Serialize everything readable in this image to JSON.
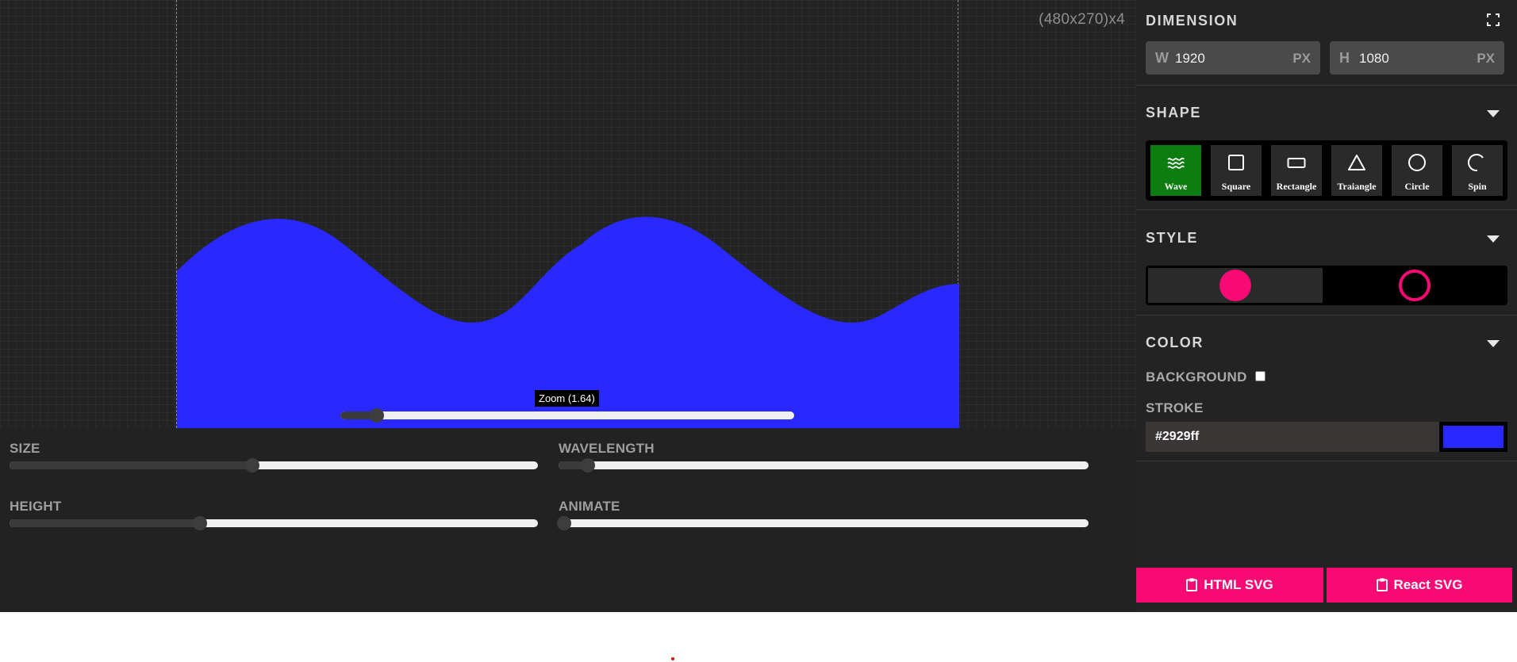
{
  "canvas": {
    "scale_label": "(480x270)x4",
    "wave_color": "#2929ff",
    "zoom": {
      "tooltip": "Zoom (1.64)",
      "value": 1.64,
      "fraction": 0.08
    }
  },
  "controls": {
    "size": {
      "label": "SIZE",
      "fraction": 0.46
    },
    "wavelength": {
      "label": "WAVELENGTH",
      "fraction": 0.055
    },
    "height": {
      "label": "HEIGHT",
      "fraction": 0.36
    },
    "animate": {
      "label": "ANIMATE",
      "fraction": 0.01
    }
  },
  "panel": {
    "dimension": {
      "title": "DIMENSION",
      "width": {
        "letter": "W",
        "value": "1920",
        "unit": "PX"
      },
      "height": {
        "letter": "H",
        "value": "1080",
        "unit": "PX"
      }
    },
    "shape": {
      "title": "SHAPE",
      "options": [
        {
          "label": "Wave",
          "icon": "wave-icon",
          "active": true
        },
        {
          "label": "Square",
          "icon": "square-icon",
          "active": false
        },
        {
          "label": "Rectangle",
          "icon": "rectangle-icon",
          "active": false
        },
        {
          "label": "Traiangle",
          "icon": "triangle-icon",
          "active": false
        },
        {
          "label": "Circle",
          "icon": "circle-icon",
          "active": false
        },
        {
          "label": "Spin",
          "icon": "spin-icon",
          "active": false
        }
      ]
    },
    "style": {
      "title": "STYLE",
      "accent": "#f80a75",
      "options": [
        "filled-circle-icon",
        "outline-circle-icon"
      ]
    },
    "color": {
      "title": "COLOR",
      "background_label": "BACKGROUND",
      "background_checked": false,
      "stroke_label": "STROKE",
      "stroke_value": "#2929ff",
      "swatch_color": "#2929ff"
    },
    "export": {
      "html_label": "HTML SVG",
      "react_label": "React SVG",
      "color": "#f80a75"
    }
  },
  "marker_color": "#e01010"
}
